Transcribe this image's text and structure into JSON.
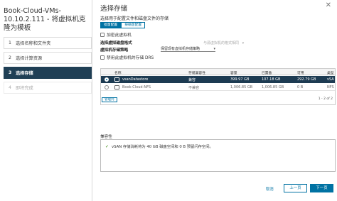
{
  "sidebar": {
    "title": "Book-Cloud-VMs-10.10.2.111 - 将虚拟机克隆为模板",
    "steps": [
      {
        "num": "1",
        "label": "选择名称和文件夹"
      },
      {
        "num": "2",
        "label": "选择计算资源"
      },
      {
        "num": "3",
        "label": "选择存储"
      },
      {
        "num": "4",
        "label": "即将完成"
      }
    ]
  },
  "main": {
    "title": "选择存储",
    "close_glyph": "✕",
    "subtitle": "选择用于配置文件和磁盘文件的存储",
    "toggle": {
      "left": "批量配置",
      "right": "按磁盘配置"
    },
    "encrypt_label": "加密此虚拟机",
    "vdisk_format_label": "选择虚拟磁盘格式",
    "vdisk_format_value": "与源虚拟机的格式相同",
    "policy_label": "虚拟机存储策略",
    "policy_value": "保留现有虚拟机存储策略",
    "drs_label": "禁用此虚拟机的存储 DRS",
    "table": {
      "headers": [
        "名称",
        "存储兼容性",
        "容量",
        "已置备",
        "可用",
        "类型"
      ],
      "rows": [
        {
          "name": "vsanDatastore",
          "compat": "兼容",
          "capacity": "399.97 GB",
          "provisioned": "107.18 GB",
          "free": "292.79 GB",
          "type": "vSA"
        },
        {
          "name": "Book-Cloud-NFS",
          "compat": "不兼容",
          "capacity": "1,006.85 GB",
          "provisioned": "1,006.85 GB",
          "free": "0 B",
          "type": "NFS"
        }
      ],
      "manage_label": "管理列",
      "pager": "1 - 2 of 2"
    },
    "compat_label": "兼容性",
    "compat_message": "vSAN 存储消耗将为 40 GB 磁盘空间和 0 B 预留闪存空间。"
  },
  "footer": {
    "cancel": "取消",
    "back": "上一页",
    "next": "下一页"
  }
}
